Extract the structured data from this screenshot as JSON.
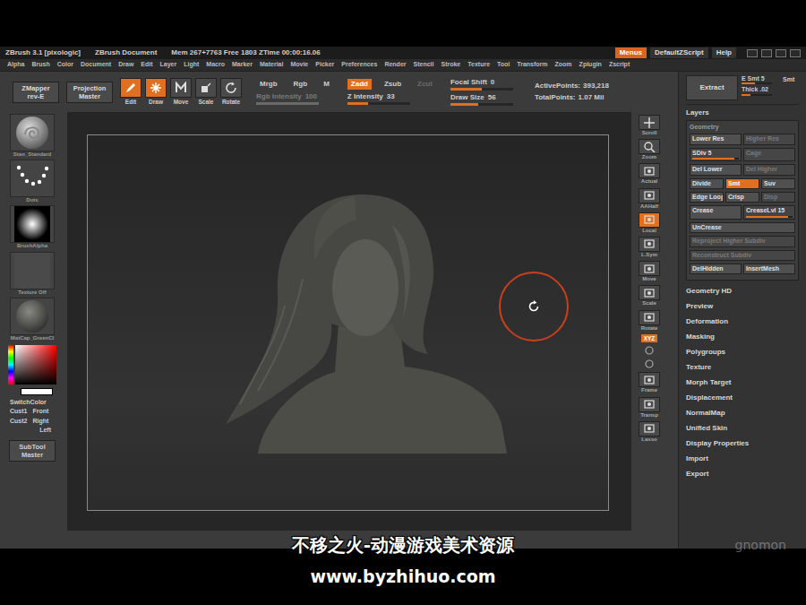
{
  "title_bar": {
    "app": "ZBrush 3.1 [pixologic]",
    "document": "ZBrush Document",
    "stats": "Mem 267+7763 Free 1803 ZTime 00:00:16.06",
    "buttons": [
      {
        "label": "Menus",
        "selected": true
      },
      {
        "label": "DefaultZScript",
        "selected": false
      },
      {
        "label": "Help",
        "selected": false
      }
    ]
  },
  "menus": [
    "Alpha",
    "Brush",
    "Color",
    "Document",
    "Draw",
    "Edit",
    "Layer",
    "Light",
    "Macro",
    "Marker",
    "Material",
    "Movie",
    "Picker",
    "Preferences",
    "Render",
    "Stencil",
    "Stroke",
    "Texture",
    "Tool",
    "Transform",
    "Zoom",
    "Zplugin",
    "Zscript"
  ],
  "top_shelf": {
    "plugins": [
      "ZMapper rev-E",
      "Projection Master"
    ],
    "modes": [
      {
        "label": "Edit",
        "selected": true
      },
      {
        "label": "Draw",
        "selected": true
      },
      {
        "label": "Move",
        "selected": false
      },
      {
        "label": "Scale",
        "selected": false
      },
      {
        "label": "Rotate",
        "selected": false
      }
    ],
    "color_modes": [
      {
        "label": "Mrgb",
        "selected": false
      },
      {
        "label": "Rgb",
        "selected": false
      },
      {
        "label": "M",
        "selected": false
      }
    ],
    "rgb_intensity": {
      "label": "Rgb Intensity",
      "value": "100",
      "level": 1,
      "disabled": true
    },
    "z_modes": [
      {
        "label": "Zadd",
        "selected": true,
        "disabled": false
      },
      {
        "label": "Zsub",
        "selected": false,
        "disabled": false
      },
      {
        "label": "Zcut",
        "selected": false,
        "disabled": true
      }
    ],
    "z_intensity": {
      "label": "Z Intensity",
      "value": "33",
      "level": 0.33,
      "disabled": false
    },
    "focal_shift": {
      "label": "Focal Shift",
      "value": "0",
      "level": 0.5,
      "disabled": false
    },
    "draw_size": {
      "label": "Draw Size",
      "value": "56",
      "level": 0.45,
      "disabled": false
    },
    "active_points": {
      "label": "ActivePoints:",
      "value": "393,218"
    },
    "total_points": {
      "label": "TotalPoints:",
      "value": "1.07 Mil"
    }
  },
  "left_shelf": {
    "thumbs": [
      {
        "label": "Stan_Standard",
        "kind": "brush"
      },
      {
        "label": "Dots",
        "kind": "stroke"
      },
      {
        "label": "BrushAlpha",
        "kind": "alpha"
      },
      {
        "label": "Texture Off",
        "kind": "texture"
      },
      {
        "label": "MatCap_GreenCl",
        "kind": "material"
      }
    ],
    "switch_color": "SwitchColor",
    "views": [
      {
        "cust": "Cust1",
        "view": "Front"
      },
      {
        "cust": "Cust2",
        "view": "Right"
      }
    ],
    "left": "Left",
    "subtool": "SubTool Master"
  },
  "right_shelf": [
    {
      "kind": "big",
      "label": "Scroll",
      "selected": false
    },
    {
      "kind": "big",
      "label": "Zoom",
      "selected": false
    },
    {
      "kind": "big",
      "label": "Actual",
      "selected": false
    },
    {
      "kind": "big",
      "label": "AAHalf",
      "selected": false
    },
    {
      "kind": "big",
      "label": "Local",
      "selected": true
    },
    {
      "kind": "big",
      "label": "L.Sym",
      "selected": false
    },
    {
      "kind": "big",
      "label": "Move",
      "selected": false
    },
    {
      "kind": "big",
      "label": "Scale",
      "selected": false
    },
    {
      "kind": "big",
      "label": "Rotate",
      "selected": false
    },
    {
      "kind": "toggle",
      "label": "XYZ",
      "selected": true
    },
    {
      "kind": "small",
      "selected": false
    },
    {
      "kind": "small",
      "selected": false
    },
    {
      "kind": "big",
      "label": "Frame",
      "selected": false
    },
    {
      "kind": "big",
      "label": "Transp",
      "selected": false
    },
    {
      "kind": "big",
      "label": "Lasso",
      "selected": false
    }
  ],
  "tool_panel": {
    "extract": {
      "label": "Extract",
      "e_smt": {
        "label": "E Smt 5",
        "level": 0.45
      },
      "smt": {
        "label": "Smt",
        "selected": false
      },
      "thick": {
        "label": "Thick .02",
        "level": 0.3
      }
    },
    "layers": "Layers",
    "geometry": {
      "title": "Geometry",
      "rows": [
        [
          {
            "kind": "button",
            "label": "Lower Res",
            "selected": false,
            "disabled": false
          },
          {
            "kind": "button",
            "label": "Higher Res",
            "selected": false,
            "disabled": true
          }
        ],
        [
          {
            "kind": "slider",
            "label": "SDiv 5",
            "level": 0.9
          },
          {
            "kind": "button",
            "label": "Cage",
            "selected": false,
            "disabled": true
          }
        ],
        [
          {
            "kind": "button",
            "label": "Del Lower",
            "selected": false,
            "disabled": false
          },
          {
            "kind": "button",
            "label": "Del Higher",
            "selected": false,
            "disabled": true
          }
        ],
        [
          {
            "kind": "button",
            "label": "Divide",
            "selected": false,
            "disabled": false
          },
          {
            "kind": "button",
            "label": "Smt",
            "selected": true,
            "disabled": false
          },
          {
            "kind": "button",
            "label": "Suv",
            "selected": false,
            "disabled": false
          }
        ],
        [
          {
            "kind": "button",
            "label": "Edge Loop",
            "selected": false,
            "disabled": false
          },
          {
            "kind": "button",
            "label": "Crisp",
            "selected": false,
            "disabled": false
          },
          {
            "kind": "button",
            "label": "Disp",
            "selected": false,
            "disabled": true
          }
        ],
        [
          {
            "kind": "button",
            "label": "Crease",
            "selected": false,
            "disabled": false
          },
          {
            "kind": "slider",
            "label": "CreaseLvl 15",
            "level": 0.9
          }
        ],
        [
          {
            "kind": "button",
            "label": "UnCrease",
            "selected": false,
            "disabled": false
          }
        ],
        [
          {
            "kind": "button",
            "label": "Reproject Higher Subdiv",
            "selected": false,
            "disabled": true
          }
        ],
        [
          {
            "kind": "button",
            "label": "Reconstruct Subdiv",
            "selected": false,
            "disabled": true
          }
        ],
        [
          {
            "kind": "button",
            "label": "DelHidden",
            "selected": false,
            "disabled": false
          },
          {
            "kind": "button",
            "label": "InsertMesh",
            "selected": false,
            "disabled": false
          }
        ]
      ]
    },
    "subpalettes": [
      "Geometry HD",
      "Preview",
      "Deformation",
      "Masking",
      "Polygroups",
      "Texture",
      "Morph Target",
      "Displacement",
      "NormalMap",
      "Unified Skin",
      "Display Properties",
      "Import",
      "Export"
    ]
  },
  "watermark": {
    "line1": "不移之火-动漫游戏美术资源",
    "line2": "www.byzhihuo.com"
  },
  "brand": "gnomon"
}
